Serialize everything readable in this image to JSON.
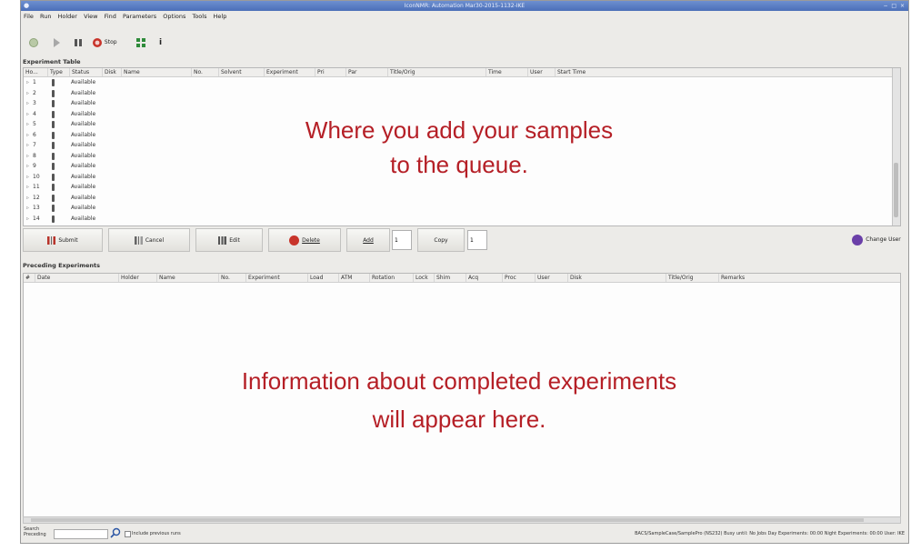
{
  "window": {
    "title": "IconNMR: Automation Mar30-2015-1132-IKE",
    "controls": "− □ ×"
  },
  "menu": [
    "File",
    "Run",
    "Holder",
    "View",
    "Find",
    "Parameters",
    "Options",
    "Tools",
    "Help"
  ],
  "toolbar": {
    "stop_label": "Stop"
  },
  "experiment_table": {
    "label": "Experiment Table",
    "columns": [
      "Ho...",
      "Type",
      "Status",
      "Disk",
      "Name",
      "No.",
      "Solvent",
      "Experiment",
      "Pri",
      "Par",
      "Title/Orig",
      "Time",
      "User",
      "Start Time"
    ],
    "rows": [
      {
        "no": "1",
        "status": "Available"
      },
      {
        "no": "2",
        "status": "Available"
      },
      {
        "no": "3",
        "status": "Available"
      },
      {
        "no": "4",
        "status": "Available"
      },
      {
        "no": "5",
        "status": "Available"
      },
      {
        "no": "6",
        "status": "Available"
      },
      {
        "no": "7",
        "status": "Available"
      },
      {
        "no": "8",
        "status": "Available"
      },
      {
        "no": "9",
        "status": "Available"
      },
      {
        "no": "10",
        "status": "Available"
      },
      {
        "no": "11",
        "status": "Available"
      },
      {
        "no": "12",
        "status": "Available"
      },
      {
        "no": "13",
        "status": "Available"
      },
      {
        "no": "14",
        "status": "Available"
      }
    ]
  },
  "actions": {
    "submit": "Submit",
    "cancel": "Cancel",
    "edit": "Edit",
    "delete": "Delete",
    "add": "Add",
    "add_count": "1",
    "copy": "Copy",
    "copy_count": "1",
    "change_user": "Change User"
  },
  "preceding": {
    "label": "Preceding Experiments",
    "columns": [
      "#",
      "Date",
      "Holder",
      "Name",
      "No.",
      "Experiment",
      "Load",
      "ATM",
      "Rotation",
      "Lock",
      "Shim",
      "Acq",
      "Proc",
      "User",
      "Disk",
      "Title/Orig",
      "Remarks"
    ]
  },
  "overlay": {
    "top_line1": "Where you add your samples",
    "top_line2": "to the queue.",
    "bottom_line1": "Information about completed experiments",
    "bottom_line2": "will appear here."
  },
  "statusbar": {
    "search_label": "Search",
    "search_scope": "Preceding",
    "include_label": "Include previous runs",
    "right_text": "BACS/SampleCase/SamplePro (NS232)   Busy until: No Jobs   Day Experiments: 00:00   Night Experiments: 00:00   User:   IKE"
  },
  "colors": {
    "overlay_text": "#b51f26",
    "titlebar": "#4b6fb8"
  }
}
